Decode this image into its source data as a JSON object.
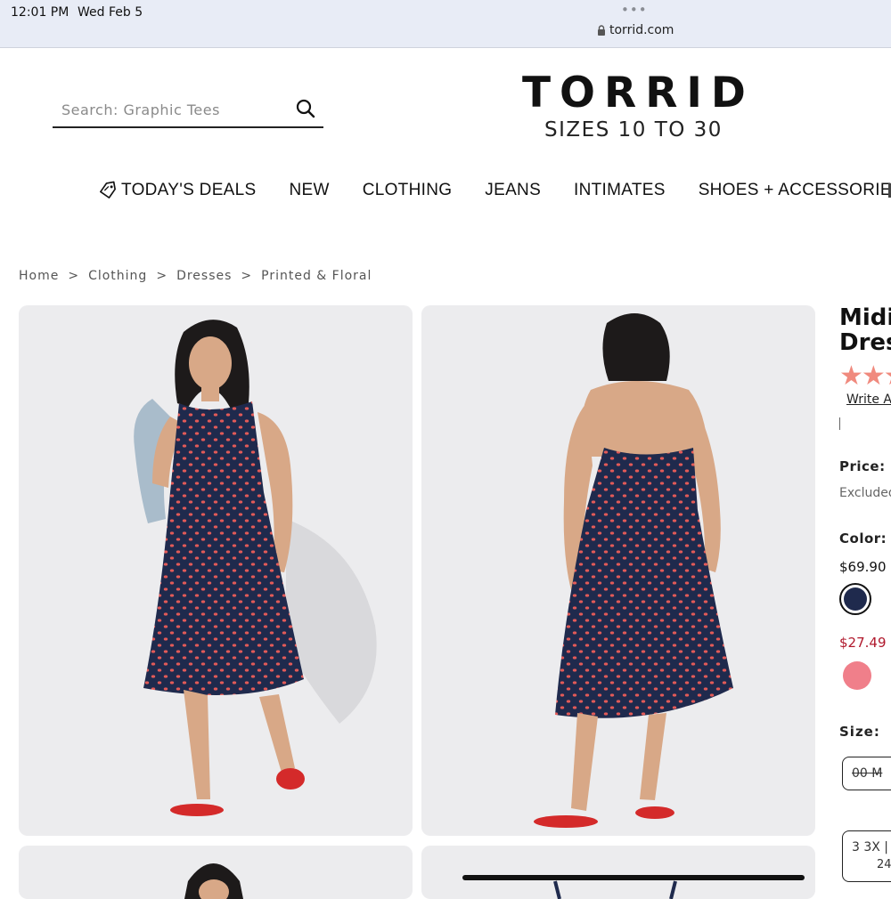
{
  "status_bar": {
    "time": "12:01 PM",
    "date": "Wed Feb 5",
    "tab_dots": "•••",
    "url": "torrid.com"
  },
  "header": {
    "search_placeholder": "Search: Graphic Tees",
    "logo": "TORRID",
    "logo_tagline": "SIZES 10 TO 30"
  },
  "nav": {
    "items": [
      "TODAY'S DEALS",
      "NEW",
      "CLOTHING",
      "JEANS",
      "INTIMATES",
      "SHOES + ACCESSORIES"
    ]
  },
  "breadcrumb": {
    "items": [
      "Home",
      "Clothing",
      "Dresses",
      "Printed & Floral"
    ],
    "separator": ">"
  },
  "product": {
    "title_line1": "Midi",
    "title_line2": "Dres",
    "stars": "★★★",
    "write_review": "Write A",
    "price_label": "Price: $",
    "excluded_text": "Excluded",
    "color_label": "Color:",
    "price_regular": "$69.90",
    "price_sale": "$27.49",
    "size_label": "Size:",
    "size_option_1": "00 M",
    "size_option_2": "3 3X |",
    "size_option_2_sub": "24"
  },
  "colors": {
    "navy_swatch": "#1f2a4d",
    "pink_swatch": "#f07f8a",
    "sale_red": "#b0182c",
    "star_color": "#f08a7e"
  }
}
